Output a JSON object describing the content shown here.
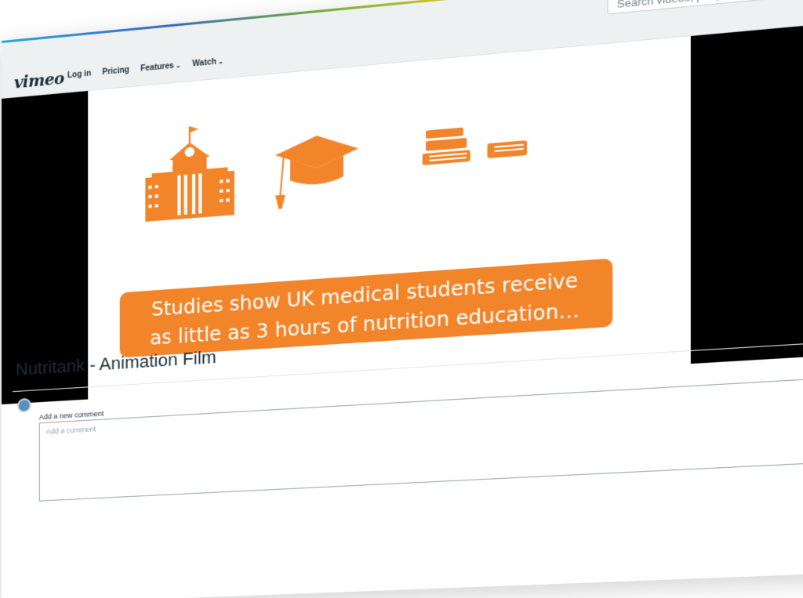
{
  "header": {
    "logo": "vimeo",
    "nav": [
      {
        "label": "Log in"
      },
      {
        "label": "Pricing"
      },
      {
        "label": "Features",
        "dropdown": true
      },
      {
        "label": "Watch",
        "dropdown": true
      }
    ],
    "search": {
      "placeholder": "Search videos, people, and more",
      "icon": "search-icon"
    }
  },
  "video": {
    "caption_line1": "Studies show UK medical students receive",
    "caption_line2": "as little as 3 hours of nutrition education…",
    "illustrations": [
      "school-building-icon",
      "graduation-cap-icon",
      "books-icon"
    ],
    "accent_color": "#f2842a"
  },
  "page": {
    "title": "Nutritank - Animation Film"
  },
  "comments": {
    "label": "Add a new comment",
    "placeholder": "Add a comment"
  }
}
